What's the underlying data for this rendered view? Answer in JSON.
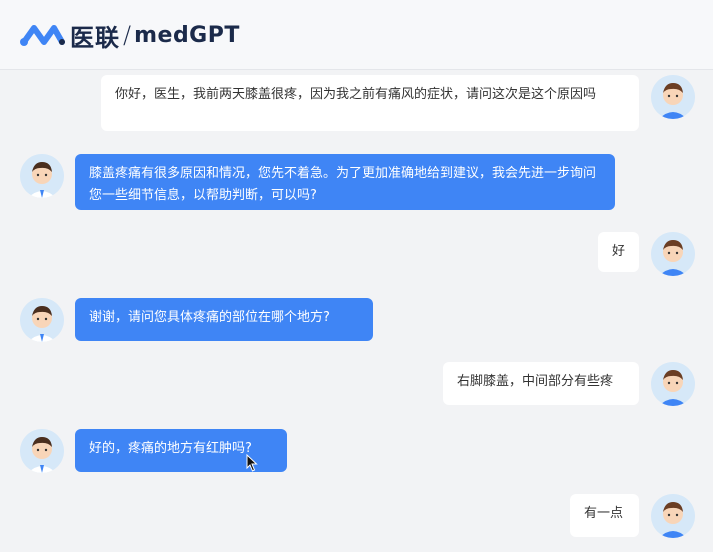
{
  "app": {
    "logo_cn": "医联",
    "logo_slash": "/",
    "logo_en": "medGPT",
    "brand_color": "#3f85f5"
  },
  "messages": [
    {
      "role": "user",
      "text": "你好，医生，我前两天膝盖很疼，因为我之前有痛风的症状，请问这次是这个原因吗"
    },
    {
      "role": "bot",
      "text": "膝盖疼痛有很多原因和情况，您先不着急。为了更加准确地给到建议，我会先进一步询问您一些细节信息，以帮助判断，可以吗?"
    },
    {
      "role": "user",
      "text": "好"
    },
    {
      "role": "bot",
      "text": "谢谢，请问您具体疼痛的部位在哪个地方?"
    },
    {
      "role": "user",
      "text": "右脚膝盖，中间部分有些疼"
    },
    {
      "role": "bot",
      "text": "好的，疼痛的地方有红肿吗?"
    },
    {
      "role": "user",
      "text": "有一点"
    }
  ]
}
